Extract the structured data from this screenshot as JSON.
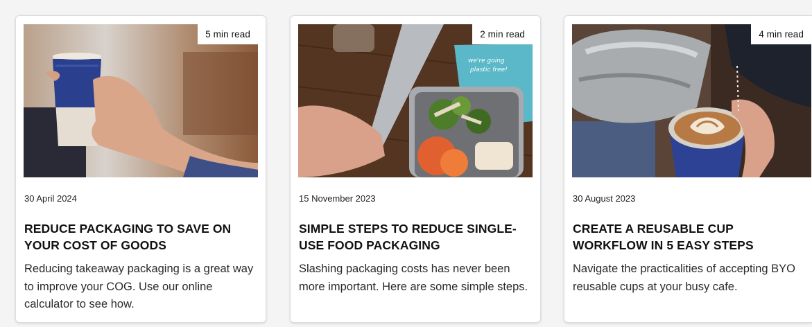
{
  "articles": [
    {
      "read_time": "5 min read",
      "date": "30 April 2024",
      "title": "REDUCE PACKAGING TO SAVE ON YOUR COST OF GOODS",
      "description": "Reducing takeaway packaging is a great way to improve your COG. Use our online calculator to see how.",
      "image_icon": "reusable-cup-photo"
    },
    {
      "read_time": "2 min read",
      "date": "15 November 2023",
      "title": "SIMPLE STEPS TO REDUCE SINGLE-USE FOOD PACKAGING",
      "description": "Slashing packaging costs has never been more important. Here are some simple steps.",
      "image_icon": "food-container-photo",
      "image_text": "we're going plastic free!"
    },
    {
      "read_time": "4 min read",
      "date": "30 August 2023",
      "title": "CREATE A REUSABLE CUP WORKFLOW IN 5 EASY STEPS",
      "description": "Navigate the practicalities of accepting BYO reusable cups at your busy cafe.",
      "image_icon": "latte-pour-photo"
    }
  ]
}
